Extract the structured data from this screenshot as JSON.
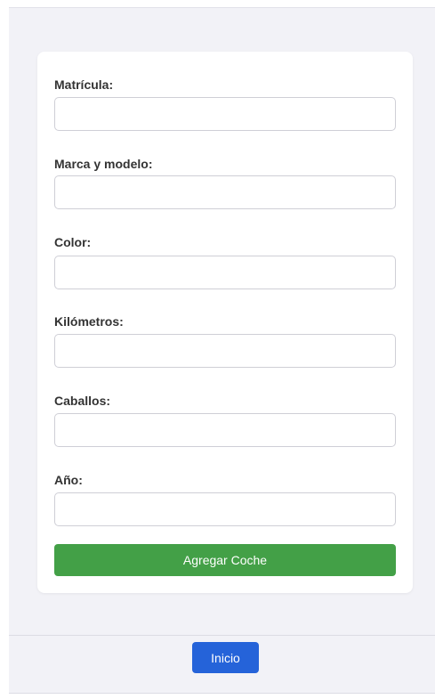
{
  "form": {
    "fields": [
      {
        "label": "Matrícula:",
        "value": ""
      },
      {
        "label": "Marca y modelo:",
        "value": ""
      },
      {
        "label": "Color:",
        "value": ""
      },
      {
        "label": "Kilómetros:",
        "value": ""
      },
      {
        "label": "Caballos:",
        "value": ""
      },
      {
        "label": "Año:",
        "value": ""
      }
    ],
    "submit_label": "Agregar Coche"
  },
  "footer": {
    "home_label": "Inicio"
  },
  "colors": {
    "submit_button": "#43a047",
    "home_button": "#2563d9",
    "page_background": "#f2f2f7",
    "card_background": "#ffffff"
  }
}
